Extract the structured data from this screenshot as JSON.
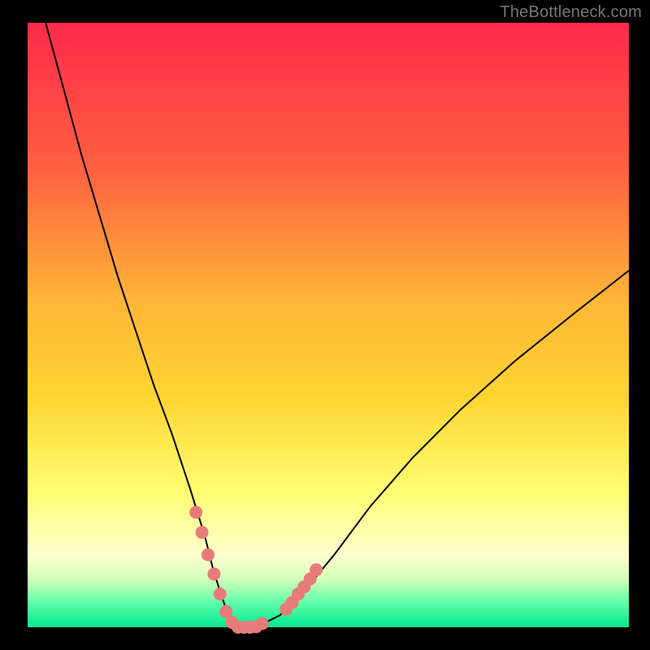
{
  "watermark": "TheBottleneck.com",
  "colors": {
    "frame": "#000000",
    "gradient_top": "#ff2a4b",
    "gradient_mid_upper": "#ff7a3a",
    "gradient_mid": "#ffd531",
    "gradient_mid_lower": "#ffff66",
    "gradient_pale": "#ffffcf",
    "gradient_green1": "#b8ff9e",
    "gradient_green2": "#4fffa0",
    "gradient_green3": "#00e88f",
    "curve_stroke": "#000000",
    "marker_fill": "#e77b7a"
  },
  "chart_data": {
    "type": "line",
    "title": "",
    "xlabel": "",
    "ylabel": "",
    "xlim": [
      0,
      100
    ],
    "ylim": [
      0,
      100
    ],
    "grid": false,
    "legend": false,
    "series": [
      {
        "name": "bottleneck-curve",
        "x": [
          3,
          6,
          9,
          12,
          15,
          18,
          21,
          24,
          27,
          29.5,
          31,
          33,
          35,
          37,
          39,
          42,
          46,
          51,
          57,
          64,
          72,
          81,
          91,
          100
        ],
        "values": [
          100,
          89,
          78,
          68,
          58,
          49,
          40,
          32,
          23,
          15,
          9,
          3,
          0,
          0,
          0.5,
          2,
          6,
          12,
          20,
          28,
          36,
          44,
          52,
          59
        ]
      }
    ],
    "markers": [
      {
        "x": 28.0,
        "y": 19.0
      },
      {
        "x": 29.0,
        "y": 15.7
      },
      {
        "x": 30.0,
        "y": 12.0
      },
      {
        "x": 31.0,
        "y": 8.8
      },
      {
        "x": 32.0,
        "y": 5.5
      },
      {
        "x": 33.0,
        "y": 2.6
      },
      {
        "x": 34.0,
        "y": 0.8
      },
      {
        "x": 35.0,
        "y": 0.0
      },
      {
        "x": 36.0,
        "y": 0.0
      },
      {
        "x": 37.0,
        "y": 0.0
      },
      {
        "x": 38.0,
        "y": 0.1
      },
      {
        "x": 39.0,
        "y": 0.6
      },
      {
        "x": 43.0,
        "y": 3.0
      },
      {
        "x": 44.0,
        "y": 4.1
      },
      {
        "x": 45.0,
        "y": 5.5
      },
      {
        "x": 46.0,
        "y": 6.7
      },
      {
        "x": 47.0,
        "y": 8.0
      },
      {
        "x": 48.0,
        "y": 9.5
      }
    ],
    "marker_radius_px": 8,
    "annotations": []
  }
}
